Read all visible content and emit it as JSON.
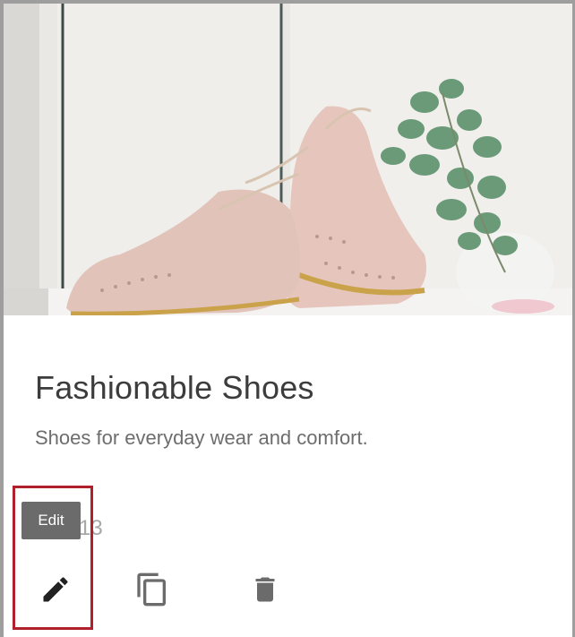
{
  "card": {
    "image_alt": "Pink brogue shoes with eucalyptus branch",
    "title": "Fashionable Shoes",
    "subtitle": "Shoes for everyday wear and comfort.",
    "date_partial": "13",
    "tooltip": "Edit"
  },
  "actions": {
    "edit": {
      "icon": "pencil-icon"
    },
    "copy": {
      "icon": "copy-icon"
    },
    "delete": {
      "icon": "trash-icon"
    }
  },
  "colors": {
    "highlight": "#b0202c",
    "icon_dark": "#222222",
    "icon_muted": "#6b6b6b",
    "tooltip_bg": "#6b6b6b"
  }
}
